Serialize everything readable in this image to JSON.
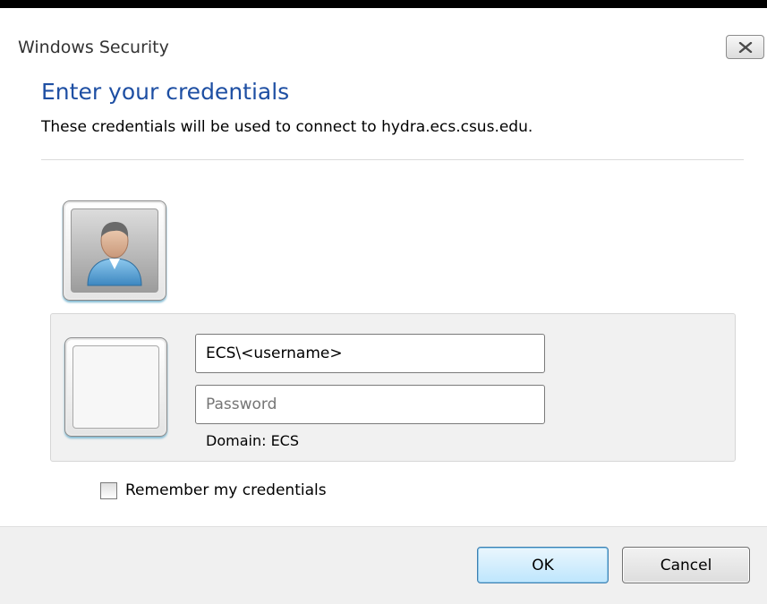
{
  "window": {
    "title": "Windows Security",
    "close_icon": "close-x-icon"
  },
  "header": {
    "heading": "Enter your credentials",
    "subtext": "These credentials will be used to connect to hydra.ecs.csus.edu."
  },
  "user_tile": {
    "icon": "user-avatar-icon"
  },
  "credentials": {
    "username_value": "ECS\\<username>",
    "password_placeholder": "Password",
    "domain_text": "Domain: ECS"
  },
  "remember": {
    "label": "Remember my credentials",
    "checked": false
  },
  "buttons": {
    "ok_label": "OK",
    "cancel_label": "Cancel"
  },
  "colors": {
    "heading": "#1e4fa3",
    "footer_bg": "#f0f0f0",
    "panel_bg": "#f1f1f1",
    "ok_border": "#3c7fb1"
  }
}
